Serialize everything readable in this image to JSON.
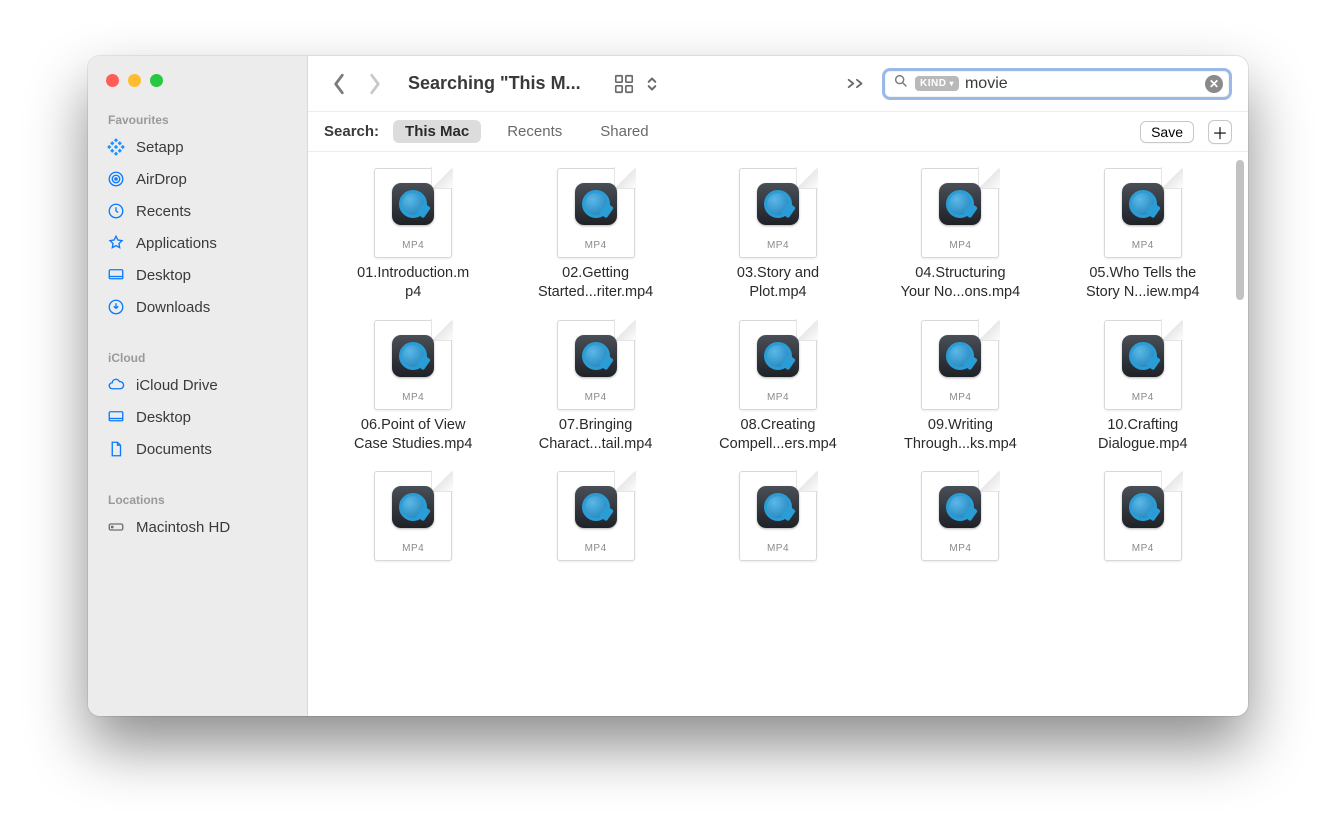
{
  "window_title": "Searching \"This M...",
  "sidebar": {
    "sections": [
      {
        "label": "Favourites",
        "items": [
          {
            "name": "Setapp",
            "icon": "setapp"
          },
          {
            "name": "AirDrop",
            "icon": "airdrop"
          },
          {
            "name": "Recents",
            "icon": "recents"
          },
          {
            "name": "Applications",
            "icon": "applications"
          },
          {
            "name": "Desktop",
            "icon": "desktop"
          },
          {
            "name": "Downloads",
            "icon": "downloads"
          }
        ]
      },
      {
        "label": "iCloud",
        "items": [
          {
            "name": "iCloud Drive",
            "icon": "cloud"
          },
          {
            "name": "Desktop",
            "icon": "desktop"
          },
          {
            "name": "Documents",
            "icon": "document"
          }
        ]
      },
      {
        "label": "Locations",
        "items": [
          {
            "name": "Macintosh HD",
            "icon": "hdd"
          }
        ]
      }
    ]
  },
  "search": {
    "token_label": "KIND",
    "query": "movie"
  },
  "scope": {
    "label": "Search:",
    "options": [
      "This Mac",
      "Recents",
      "Shared"
    ],
    "active": "This Mac",
    "save_label": "Save"
  },
  "files": [
    {
      "line1": "01.Introduction.m",
      "line2": "p4",
      "ext": "MP4"
    },
    {
      "line1": "02.Getting",
      "line2": "Started...riter.mp4",
      "ext": "MP4"
    },
    {
      "line1": "03.Story and",
      "line2": "Plot.mp4",
      "ext": "MP4"
    },
    {
      "line1": "04.Structuring",
      "line2": "Your No...ons.mp4",
      "ext": "MP4"
    },
    {
      "line1": "05.Who Tells the",
      "line2": "Story N...iew.mp4",
      "ext": "MP4"
    },
    {
      "line1": "06.Point of View",
      "line2": "Case Studies.mp4",
      "ext": "MP4"
    },
    {
      "line1": "07.Bringing",
      "line2": "Charact...tail.mp4",
      "ext": "MP4"
    },
    {
      "line1": "08.Creating",
      "line2": "Compell...ers.mp4",
      "ext": "MP4"
    },
    {
      "line1": "09.Writing",
      "line2": "Through...ks.mp4",
      "ext": "MP4"
    },
    {
      "line1": "10.Crafting",
      "line2": "Dialogue.mp4",
      "ext": "MP4"
    },
    {
      "line1": "",
      "line2": "",
      "ext": "MP4"
    },
    {
      "line1": "",
      "line2": "",
      "ext": "MP4"
    },
    {
      "line1": "",
      "line2": "",
      "ext": "MP4"
    },
    {
      "line1": "",
      "line2": "",
      "ext": "MP4"
    },
    {
      "line1": "",
      "line2": "",
      "ext": "MP4"
    }
  ]
}
